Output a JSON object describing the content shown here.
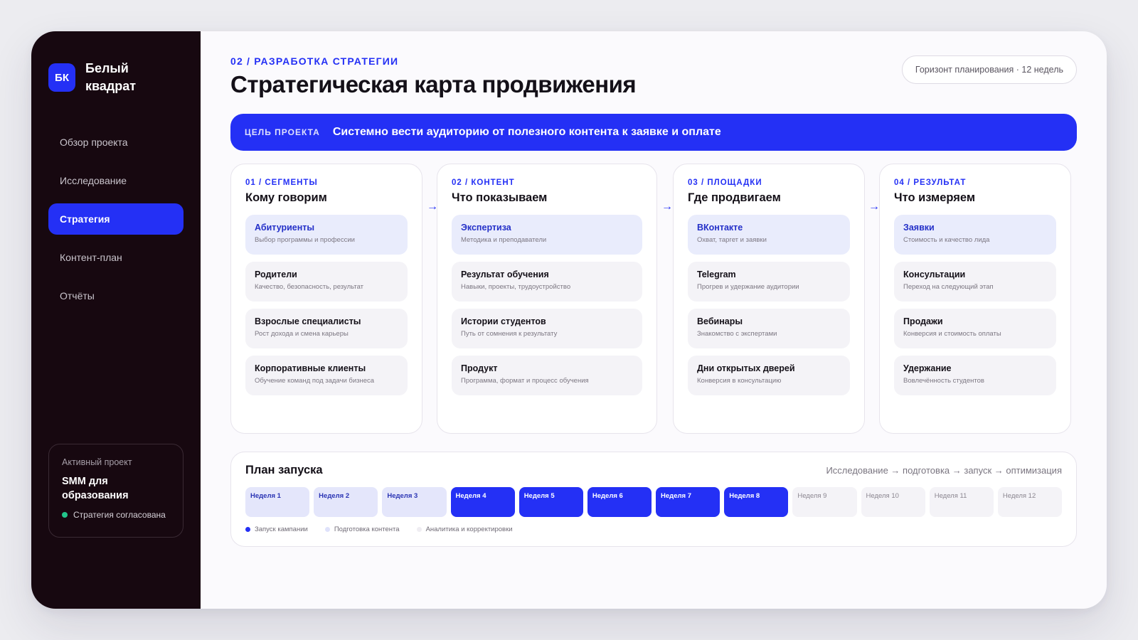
{
  "brand": {
    "logo": "БК",
    "name": "Белый квадрат"
  },
  "nav": [
    {
      "label": "Обзор проекта",
      "active": false
    },
    {
      "label": "Исследование",
      "active": false
    },
    {
      "label": "Стратегия",
      "active": true
    },
    {
      "label": "Контент-план",
      "active": false
    },
    {
      "label": "Отчёты",
      "active": false
    }
  ],
  "project": {
    "label": "Активный проект",
    "name": "SMM для образования",
    "status": "Стратегия согласована",
    "status_color": "#22c58b"
  },
  "header": {
    "eyebrow": "02 / РАЗРАБОТКА СТРАТЕГИИ",
    "title": "Стратегическая карта продвижения",
    "horizon": "Горизонт планирования · 12 недель"
  },
  "goal": {
    "label": "ЦЕЛЬ ПРОЕКТА",
    "text": "Системно вести аудиторию от полезного контента к заявке и оплате"
  },
  "arrow_glyph": "→",
  "columns": [
    {
      "eyebrow": "01 / СЕГМЕНТЫ",
      "title": "Кому говорим",
      "items": [
        {
          "title": "Абитуриенты",
          "desc": "Выбор программы и профессии"
        },
        {
          "title": "Родители",
          "desc": "Качество, безопасность, результат"
        },
        {
          "title": "Взрослые специалисты",
          "desc": "Рост дохода и смена карьеры"
        },
        {
          "title": "Корпоративные клиенты",
          "desc": "Обучение команд под задачи бизнеса"
        }
      ]
    },
    {
      "eyebrow": "02 / КОНТЕНТ",
      "title": "Что показываем",
      "items": [
        {
          "title": "Экспертиза",
          "desc": "Методика и преподаватели"
        },
        {
          "title": "Результат обучения",
          "desc": "Навыки, проекты, трудоустройство"
        },
        {
          "title": "Истории студентов",
          "desc": "Путь от сомнения к результату"
        },
        {
          "title": "Продукт",
          "desc": "Программа, формат и процесс обучения"
        }
      ]
    },
    {
      "eyebrow": "03 / ПЛОЩАДКИ",
      "title": "Где продвигаем",
      "items": [
        {
          "title": "ВКонтакте",
          "desc": "Охват, таргет и заявки"
        },
        {
          "title": "Telegram",
          "desc": "Прогрев и удержание аудитории"
        },
        {
          "title": "Вебинары",
          "desc": "Знакомство с экспертами"
        },
        {
          "title": "Дни открытых дверей",
          "desc": "Конверсия в консультацию"
        }
      ]
    },
    {
      "eyebrow": "04 / РЕЗУЛЬТАТ",
      "title": "Что измеряем",
      "items": [
        {
          "title": "Заявки",
          "desc": "Стоимость и качество лида"
        },
        {
          "title": "Консультации",
          "desc": "Переход на следующий этап"
        },
        {
          "title": "Продажи",
          "desc": "Конверсия и стоимость оплаты"
        },
        {
          "title": "Удержание",
          "desc": "Вовлечённость студентов"
        }
      ]
    }
  ],
  "plan": {
    "title": "План запуска",
    "flow": "Исследование → подготовка → запуск → оптимизация",
    "weeks": [
      {
        "label": "Неделя 1",
        "phase": "prep"
      },
      {
        "label": "Неделя 2",
        "phase": "prep"
      },
      {
        "label": "Неделя 3",
        "phase": "prep"
      },
      {
        "label": "Неделя 4",
        "phase": "launch"
      },
      {
        "label": "Неделя 5",
        "phase": "launch"
      },
      {
        "label": "Неделя 6",
        "phase": "launch"
      },
      {
        "label": "Неделя 7",
        "phase": "launch"
      },
      {
        "label": "Неделя 8",
        "phase": "launch"
      },
      {
        "label": "Неделя 9",
        "phase": "analytics"
      },
      {
        "label": "Неделя 10",
        "phase": "analytics"
      },
      {
        "label": "Неделя 11",
        "phase": "analytics"
      },
      {
        "label": "Неделя 12",
        "phase": "analytics"
      }
    ],
    "legend": [
      {
        "label": "Запуск кампании",
        "color": "#2430f5"
      },
      {
        "label": "Подготовка контента",
        "color": "#dfe2fb"
      },
      {
        "label": "Аналитика и корректировки",
        "color": "#efedf2"
      }
    ]
  },
  "colors": {
    "accent": "#2430f5",
    "sidebar": "#170810"
  }
}
